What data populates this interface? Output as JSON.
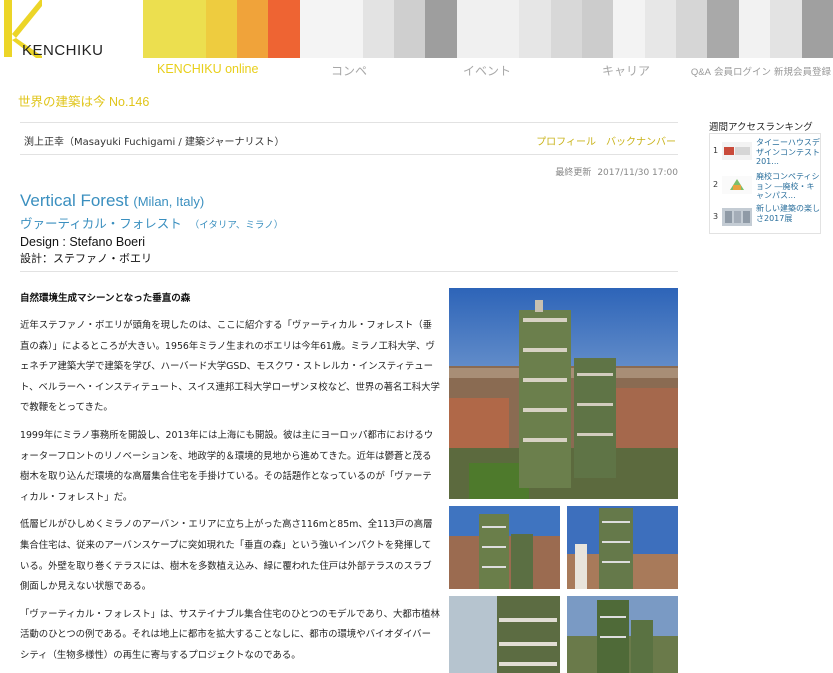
{
  "site": {
    "logo_text": "KENCHIKU",
    "stripe_colors": [
      "#ecdf4f",
      "#ecdf4f",
      "#eecc3f",
      "#f0a33a",
      "#ee6433",
      "#f4f4f4",
      "#f4f4f4",
      "#e3e3e3",
      "#cfcfcf",
      "#9e9e9e",
      "#f0f0f0",
      "#f0f0f0",
      "#e6e6e6",
      "#d8d8d8",
      "#cccccc",
      "#f3f3f3",
      "#e7e7e7",
      "#d6d6d6",
      "#a9a9a9",
      "#f2f2f2",
      "#e3e3e3",
      "#a0a0a0"
    ]
  },
  "nav": {
    "items": [
      "KENCHIKU online",
      "コンペ",
      "イベント",
      "キャリア"
    ],
    "links": [
      "Q&A",
      "会員ログイン",
      "新規会員登録"
    ]
  },
  "section_title": "世界の建築は今 No.146",
  "author": {
    "name": "渕上正幸（Masayuki Fuchigami / 建築ジャーナリスト）",
    "profile_label": "プロフィール",
    "backnumber_label": "バックナンバー"
  },
  "updated": {
    "label": "最終更新",
    "datetime": "2017/11/30 17:00"
  },
  "article": {
    "title_en": "Vertical Forest",
    "place_en": "(Milan, Italy)",
    "title_jp": "ヴァーティカル・フォレスト",
    "place_jp": "（イタリア、ミラノ）",
    "design_en": "Design : Stefano Boeri",
    "design_jp": "設計：ステファノ・ボエリ",
    "lead": "自然環境生成マシーンとなった垂直の森",
    "paragraphs": [
      "近年ステファノ・ボエリが頭角を現したのは、ここに紹介する「ヴァーティカル・フォレスト（垂直の森）」によるところが大きい。1956年ミラノ生まれのボエリは今年61歳。ミラノ工科大学、ヴェネチア建築大学で建築を学び、ハーバード大学GSD、モスクワ・ストレルカ・インスティテュート、ベルラーヘ・インスティテュート、スイス連邦工科大学ローザンヌ校など、世界の著名工科大学で教鞭をとってきた。",
      "1999年にミラノ事務所を開設し、2013年には上海にも開設。彼は主にヨーロッパ都市におけるウォーターフロントのリノベーションを、地政学的＆環境的見地から進めてきた。近年は鬱蒼と茂る樹木を取り込んだ環境的な高層集合住宅を手掛けている。その話題作となっているのが「ヴァーティカル・フォレスト」だ。",
      "低層ビルがひしめくミラノのアーバン・エリアに立ち上がった高さ116mと85m、全113戸の高層集合住宅は、従来のアーバンスケープに突如現れた「垂直の森」という強いインパクトを発揮している。外壁を取り巻くテラスには、樹木を多数植え込み、緑に覆われた住戸は外部テラスのスラブ側面しか見えない状態である。",
      "「ヴァーティカル・フォレスト」は、サステイナブル集合住宅のひとつのモデルであり、大都市植林活動のひとつの例である。それは地上に都市を拡大することなしに、都市の環境やバイオダイバーシティ（生物多様性）の再生に寄与するプロジェクトなのである。"
    ]
  },
  "ranking": {
    "title": "週間アクセスランキング",
    "items": [
      {
        "num": "1",
        "text": "タイニーハウスデザインコンテスト201..."
      },
      {
        "num": "2",
        "text": "廃校コンペティション ―廃校・キャンパス..."
      },
      {
        "num": "3",
        "text": "新しい建築の楽しさ2017展"
      }
    ]
  }
}
